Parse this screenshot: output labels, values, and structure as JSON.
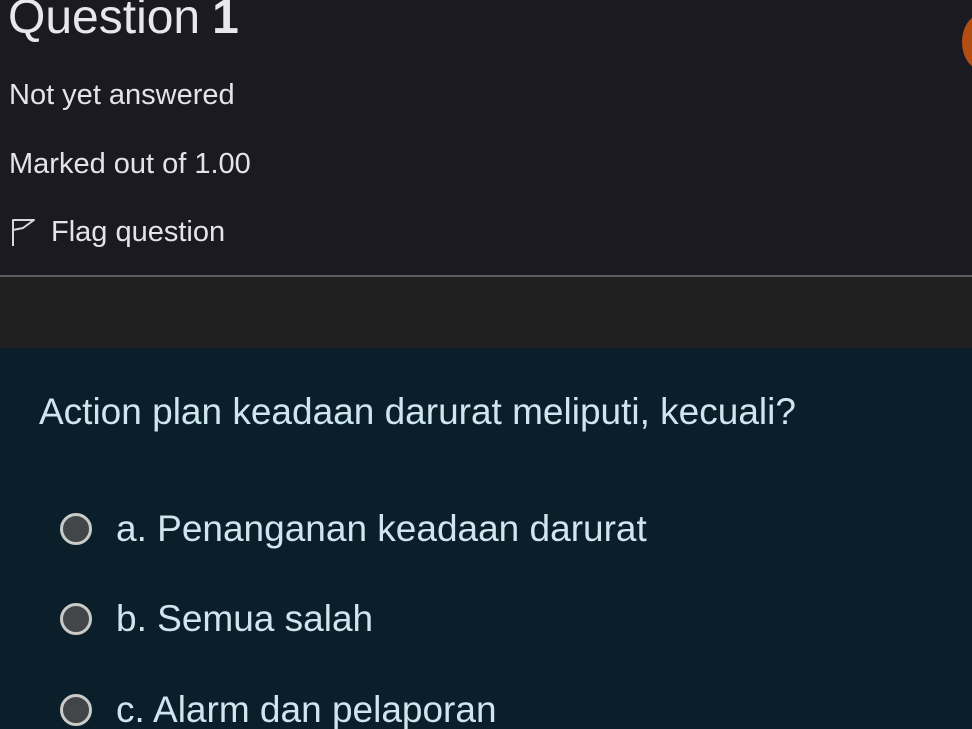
{
  "info": {
    "question_label": "Question",
    "question_number": "1",
    "state": "Not yet answered",
    "marks": "Marked out of 1.00",
    "flag_label": "Flag question"
  },
  "question": {
    "text": "Action plan keadaan darurat meliputi, kecuali?",
    "options": [
      {
        "letter": "a.",
        "label": "Penanganan keadaan darurat",
        "selected": false
      },
      {
        "letter": "b.",
        "label": "Semua salah",
        "selected": false
      },
      {
        "letter": "c.",
        "label": "Alarm dan pelaporan",
        "selected": false
      }
    ]
  },
  "icons": {
    "flag": "flag-outline-icon",
    "radio": "radio-unchecked-icon"
  },
  "colors": {
    "info_background": "#1b1a23",
    "content_background": "#0a1f29",
    "question_text": "#cde6ef",
    "accent_orange": "#b44d12"
  }
}
